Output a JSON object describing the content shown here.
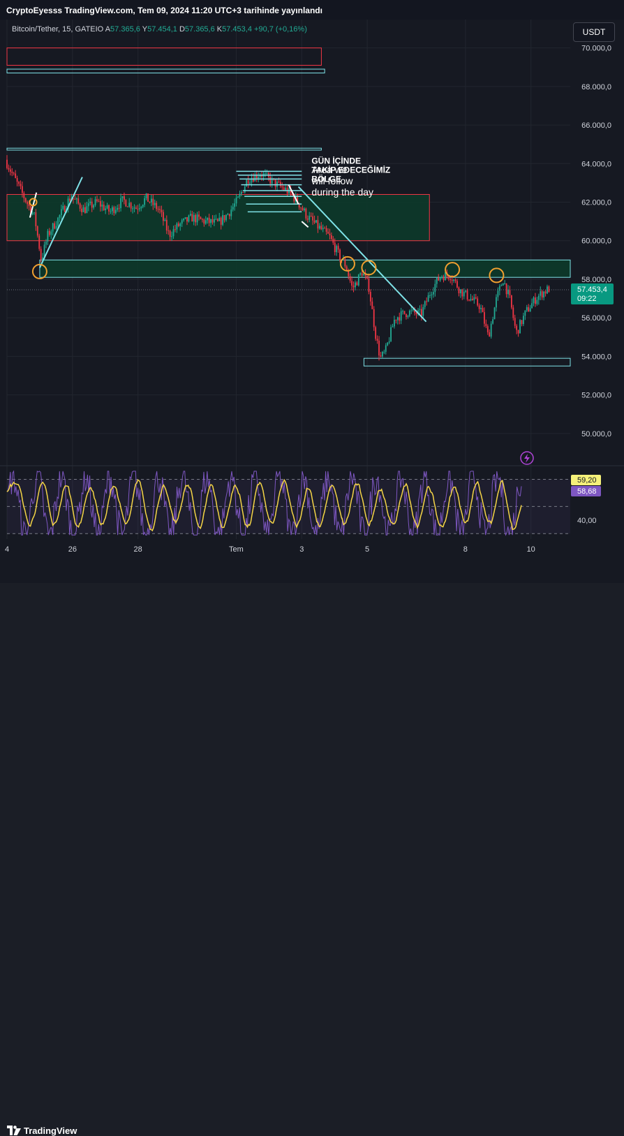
{
  "publisher_line": "CryptoEyesss TradingView.com, Tem 09, 2024 11:20 UTC+3 tarihinde yayınlandı",
  "symbol": "Bitcoin/Tether, 15, GATEIO",
  "ohlc": [
    {
      "key": "A",
      "value": "57.365,6"
    },
    {
      "key": "Y",
      "value": "57.454,1"
    },
    {
      "key": "D",
      "value": "57.365,6"
    },
    {
      "key": "K",
      "value": "57.453,4"
    }
  ],
  "change": "+90,7 (+0,16%)",
  "currency_button": "USDT",
  "brand": "TradingView",
  "colors": {
    "up": "#22ab94",
    "down": "#f23645",
    "zone_border_cyan": "#7fe3e8",
    "zone_border_red": "#f23645",
    "zone_fill_green": "#0c3a2a",
    "circle": "#f0a030",
    "rsi_line": "#7e57c2",
    "rsi_ma": "#f5d547",
    "price_label_bg": "#089981",
    "rsi_label_yellow": "#f5f17a",
    "rsi_label_purple": "#7e57c2"
  },
  "chart_data": {
    "type": "candlestick",
    "price_axis": {
      "ticks": [
        "70.000,0",
        "68.000,0",
        "66.000,0",
        "64.000,0",
        "62.000,0",
        "60.000,0",
        "58.000,0",
        "56.000,0",
        "54.000,0",
        "52.000,0",
        "50.000,0"
      ],
      "tick_values": [
        70000,
        68000,
        66000,
        64000,
        62000,
        60000,
        58000,
        56000,
        54000,
        52000,
        50000
      ],
      "ylim": [
        48400,
        71400
      ]
    },
    "x_axis": {
      "ticks": [
        {
          "label": "4",
          "day": 24
        },
        {
          "label": "26",
          "day": 26
        },
        {
          "label": "28",
          "day": 28
        },
        {
          "label": "Tem",
          "day": 31
        },
        {
          "label": "3",
          "day": 33
        },
        {
          "label": "5",
          "day": 35
        },
        {
          "label": "8",
          "day": 38
        },
        {
          "label": "10",
          "day": 40
        }
      ],
      "xlim": [
        24,
        41.2
      ]
    },
    "series_path": [
      [
        24.0,
        64200
      ],
      [
        24.5,
        62500
      ],
      [
        24.9,
        61200
      ],
      [
        25.1,
        59000
      ],
      [
        25.3,
        60300
      ],
      [
        25.6,
        61100
      ],
      [
        26.0,
        62300
      ],
      [
        26.4,
        61600
      ],
      [
        26.8,
        62000
      ],
      [
        27.2,
        61500
      ],
      [
        27.6,
        62100
      ],
      [
        28.0,
        61700
      ],
      [
        28.3,
        62200
      ],
      [
        28.7,
        61600
      ],
      [
        29.0,
        60300
      ],
      [
        29.3,
        60800
      ],
      [
        29.7,
        61200
      ],
      [
        30.1,
        61000
      ],
      [
        30.5,
        60900
      ],
      [
        30.8,
        61400
      ],
      [
        31.1,
        62100
      ],
      [
        31.4,
        63200
      ],
      [
        31.8,
        63500
      ],
      [
        32.2,
        63000
      ],
      [
        32.6,
        62600
      ],
      [
        32.9,
        62100
      ],
      [
        33.2,
        61300
      ],
      [
        33.5,
        60800
      ],
      [
        33.9,
        60200
      ],
      [
        34.2,
        59200
      ],
      [
        34.4,
        58700
      ],
      [
        34.6,
        57500
      ],
      [
        34.9,
        58400
      ],
      [
        35.1,
        57600
      ],
      [
        35.3,
        55200
      ],
      [
        35.45,
        53900
      ],
      [
        35.6,
        54200
      ],
      [
        35.9,
        56000
      ],
      [
        36.3,
        56300
      ],
      [
        36.7,
        56200
      ],
      [
        37.0,
        57400
      ],
      [
        37.3,
        58200
      ],
      [
        37.6,
        58200
      ],
      [
        37.9,
        57400
      ],
      [
        38.2,
        57000
      ],
      [
        38.5,
        56600
      ],
      [
        38.75,
        55000
      ],
      [
        39.0,
        57000
      ],
      [
        39.2,
        58000
      ],
      [
        39.4,
        57000
      ],
      [
        39.6,
        55200
      ],
      [
        39.9,
        56300
      ],
      [
        40.2,
        57000
      ],
      [
        40.4,
        57300
      ],
      [
        40.6,
        57500
      ]
    ],
    "last_price": {
      "value": 57453.4,
      "label": "57.453,4",
      "countdown": "09:22"
    },
    "zones": [
      {
        "name": "red-zone-70k",
        "x0": 24.0,
        "x1": 33.6,
        "y0": 69100,
        "y1": 70000,
        "border": "red",
        "fill": "none"
      },
      {
        "name": "cyan-line-69k",
        "x0": 24.0,
        "x1": 33.7,
        "y0": 68700,
        "y1": 68900,
        "border": "cyan",
        "fill": "none"
      },
      {
        "name": "cyan-line-64k",
        "x0": 24.0,
        "x1": 33.6,
        "y0": 64700,
        "y1": 64800,
        "border": "cyan",
        "fill": "none"
      },
      {
        "name": "red-green-zone-61k",
        "x0": 24.0,
        "x1": 36.9,
        "y0": 60000,
        "y1": 62400,
        "border": "red",
        "fill": "green"
      },
      {
        "name": "cyan-green-zone-58k",
        "x0": 25.0,
        "x1": 41.2,
        "y0": 58100,
        "y1": 59000,
        "border": "cyan",
        "fill": "green"
      },
      {
        "name": "cyan-zone-54k",
        "x0": 34.9,
        "x1": 41.2,
        "y0": 53500,
        "y1": 53900,
        "border": "cyan",
        "fill": "none"
      }
    ],
    "circles": [
      {
        "x": 25.0,
        "y": 58400
      },
      {
        "x": 34.4,
        "y": 58800
      },
      {
        "x": 35.05,
        "y": 58600
      },
      {
        "x": 37.6,
        "y": 58500
      },
      {
        "x": 38.95,
        "y": 58200
      }
    ],
    "annotations": [
      {
        "text_lines": [
          "GÜN İÇİNDE",
          "TAKİP EDECEĞİMİZ",
          "BÖLGE"
        ],
        "x": 33.3,
        "y": 64000
      },
      {
        "text_lines": [
          "Area we",
          "will follow",
          "during the day"
        ],
        "x": 33.3,
        "y": 63500
      }
    ],
    "rsi": {
      "current": "58,68",
      "ma": "59,20",
      "tick": "40,00",
      "levels": [
        70,
        50,
        30
      ],
      "ylim": [
        26,
        78
      ]
    }
  }
}
